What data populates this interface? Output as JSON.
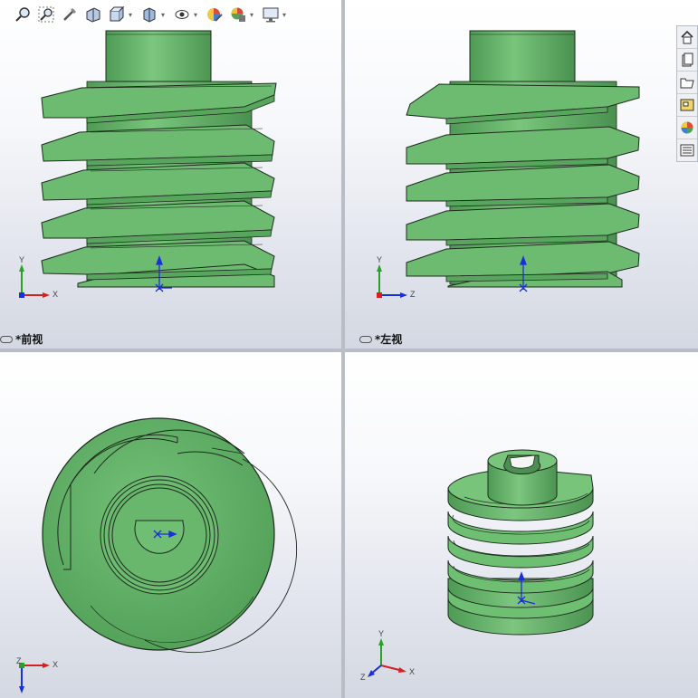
{
  "viewports": {
    "front": {
      "label": "*前视"
    },
    "left": {
      "label": "*左视"
    },
    "top": {
      "label": ""
    },
    "iso": {
      "label": ""
    }
  },
  "toolbar": {
    "icons": [
      "zoom-to-fit-icon",
      "zoom-to-area-icon",
      "previous-view-icon",
      "section-view-icon",
      "view-orientation-icon",
      "display-style-icon",
      "hide-show-items-icon",
      "edit-appearance-icon",
      "apply-scene-icon",
      "view-settings-icon"
    ]
  },
  "taskpane": {
    "icons": [
      "home-icon",
      "design-library-icon",
      "file-explorer-icon",
      "view-palette-icon",
      "appearances-icon",
      "custom-properties-icon"
    ]
  },
  "triad": {
    "front": {
      "h": "X",
      "v": "Y"
    },
    "left": {
      "h": "Z",
      "v": "Y"
    },
    "top": {
      "h": "X",
      "v": "Z"
    },
    "iso": {
      "h": "X",
      "v": "Y",
      "d": "Z"
    }
  },
  "colors": {
    "part_green": "#6fbf73",
    "part_green_dark": "#4e9a55",
    "part_edge": "#1d2a1d",
    "origin_blue": "#1a2fd6",
    "axis_red": "#d42020",
    "axis_green": "#2aa02a"
  }
}
